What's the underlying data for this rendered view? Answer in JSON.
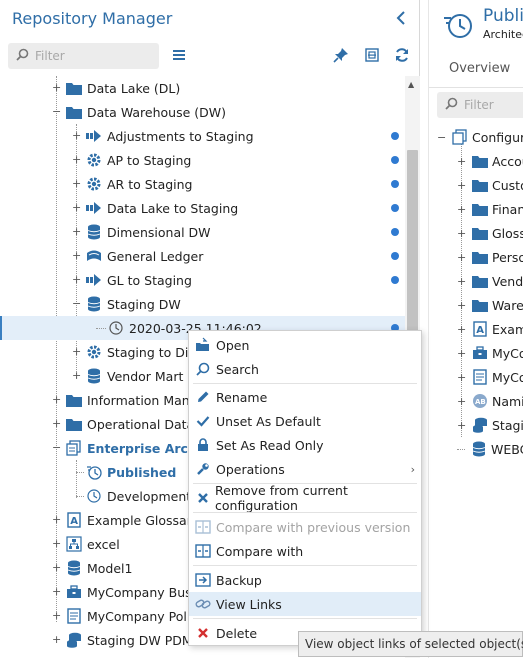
{
  "left_pane": {
    "title": "Repository Manager",
    "filter_placeholder": "Filter",
    "tree": [
      {
        "label": "Data Lake (DL)",
        "icon": "folder-icon",
        "dot": false
      },
      {
        "label": "Data Warehouse (DW)",
        "icon": "folder-icon",
        "dot": false
      },
      {
        "label": "Adjustments to Staging",
        "icon": "mapping-arrow-icon",
        "dot": true
      },
      {
        "label": "AP to Staging",
        "icon": "gear-icon",
        "dot": true
      },
      {
        "label": "AR to Staging",
        "icon": "gear-icon",
        "dot": true
      },
      {
        "label": "Data Lake to Staging",
        "icon": "mapping-arrow-icon",
        "dot": true
      },
      {
        "label": "Dimensional DW",
        "icon": "database-icon",
        "dot": true
      },
      {
        "label": "General Ledger",
        "icon": "ledger-icon",
        "dot": true
      },
      {
        "label": "GL to Staging",
        "icon": "mapping-arrow-icon",
        "dot": true
      },
      {
        "label": "Staging DW",
        "icon": "database-icon",
        "dot": false
      },
      {
        "label": "2020-03-25 11:46:02",
        "icon": "clock-icon",
        "dot": true
      },
      {
        "label": "Staging to Dim",
        "icon": "gear-icon",
        "dot": false
      },
      {
        "label": "Vendor Mart",
        "icon": "database-icon",
        "dot": false
      },
      {
        "label": "Information Mana",
        "icon": "folder-icon",
        "dot": false
      },
      {
        "label": "Operational Data S",
        "icon": "folder-icon",
        "dot": false
      },
      {
        "label": "Enterprise Architect",
        "icon": "configuration-icon",
        "dot": false
      },
      {
        "label": "Published",
        "icon": "published-clock-icon",
        "dot": false
      },
      {
        "label": "Development",
        "icon": "clock-icon",
        "dot": false
      },
      {
        "label": "Example Glossary",
        "icon": "glossary-icon",
        "dot": false
      },
      {
        "label": "excel",
        "icon": "hierarchy-icon",
        "dot": false
      },
      {
        "label": "Model1",
        "icon": "database-icon",
        "dot": false
      },
      {
        "label": "MyCompany Busin",
        "icon": "briefcase-icon",
        "dot": false
      },
      {
        "label": "MyCompany Policy",
        "icon": "document-icon",
        "dot": false
      },
      {
        "label": "Staging DW PDM",
        "icon": "database-stack-icon",
        "dot": false
      }
    ]
  },
  "context_menu": {
    "items": [
      {
        "label": "Open",
        "icon": "open-icon",
        "disabled": false
      },
      {
        "label": "Search",
        "icon": "search-icon",
        "disabled": false
      },
      {
        "label": "Rename",
        "icon": "pencil-icon",
        "disabled": false
      },
      {
        "label": "Unset As Default",
        "icon": "checkmark-icon",
        "disabled": false
      },
      {
        "label": "Set As Read Only",
        "icon": "lock-icon",
        "disabled": false
      },
      {
        "label": "Operations",
        "icon": "wrench-icon",
        "disabled": false
      },
      {
        "label": "Remove from current configuration",
        "icon": "remove-x-icon",
        "disabled": false
      },
      {
        "label": "Compare with previous version",
        "icon": "compare-icon",
        "disabled": true
      },
      {
        "label": "Compare with",
        "icon": "compare-icon",
        "disabled": false
      },
      {
        "label": "Backup",
        "icon": "backup-icon",
        "disabled": false
      },
      {
        "label": "View Links",
        "icon": "link-icon",
        "disabled": false
      },
      {
        "label": "Delete",
        "icon": "delete-x-icon",
        "disabled": false
      }
    ],
    "submenu_arrow": "›"
  },
  "tooltip": "View object links of selected object(s).",
  "right_pane": {
    "title": "Publi",
    "subtitle": "Architec",
    "tab": "Overview",
    "filter_placeholder": "Filter",
    "tree": [
      {
        "label": "Configura",
        "icon": "configuration-icon"
      },
      {
        "label": "Accou",
        "icon": "folder-icon"
      },
      {
        "label": "Custo",
        "icon": "folder-icon"
      },
      {
        "label": "Finan",
        "icon": "folder-icon"
      },
      {
        "label": "Gloss",
        "icon": "folder-icon"
      },
      {
        "label": "Perso",
        "icon": "folder-icon"
      },
      {
        "label": "Vendo",
        "icon": "folder-icon"
      },
      {
        "label": "Ware",
        "icon": "folder-icon"
      },
      {
        "label": "Exam",
        "icon": "glossary-icon"
      },
      {
        "label": "MyCo",
        "icon": "briefcase-icon"
      },
      {
        "label": "MyCo",
        "icon": "document-icon"
      },
      {
        "label": "Nami",
        "icon": "naming-icon"
      },
      {
        "label": "Stagi",
        "icon": "database-stack-icon"
      },
      {
        "label": "WEBC",
        "icon": "database-icon"
      }
    ]
  },
  "colors": {
    "accent": "#2f6ea7",
    "folder": "#2f6ea7",
    "dot": "#2f7ad1",
    "hover": "#e1edf8",
    "delete": "#d32f2f"
  }
}
